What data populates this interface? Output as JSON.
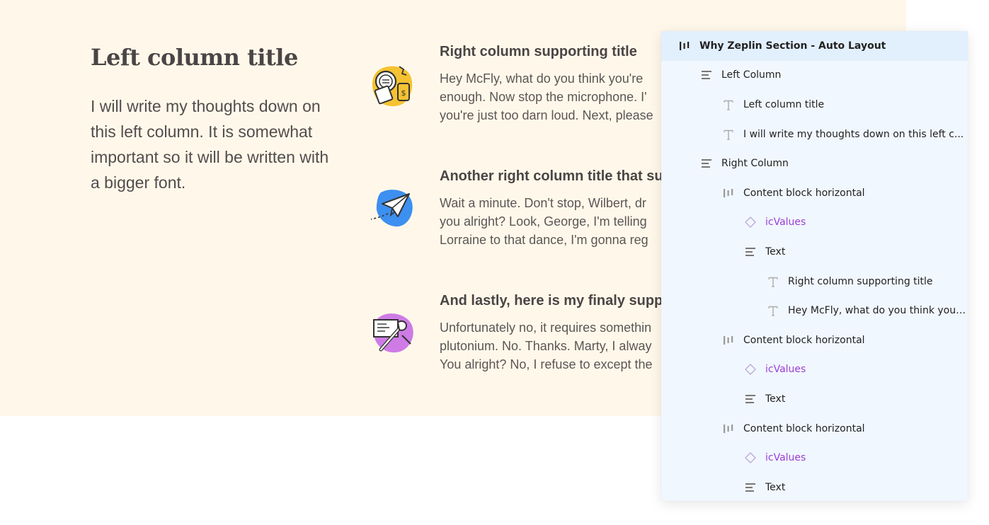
{
  "left_column": {
    "title": "Left column title",
    "body": "I will write my thoughts down on this left column. It is somewhat important so it will be written with a bigger font."
  },
  "right_column": {
    "blocks": [
      {
        "icon": "magnifier-phone-money-icon",
        "title": "Right column supporting title",
        "lines": [
          "Hey McFly, what do you think you're",
          "enough. Now stop the microphone. I'",
          "you're just too darn loud. Next, please"
        ]
      },
      {
        "icon": "paper-plane-icon",
        "title": "Another right column title that su",
        "lines": [
          "Wait a minute. Don't stop, Wilbert, dr",
          "you alright? Look, George, I'm telling",
          "Lorraine to that dance, I'm gonna reg"
        ]
      },
      {
        "icon": "document-wrench-icon",
        "title": "And lastly, here is my finaly supp",
        "lines": [
          "Unfortunately no, it requires somethin",
          "plutonium. No. Thanks. Marty, I alway",
          "You alright? No, I refuse to except the"
        ]
      }
    ]
  },
  "layers_panel": {
    "items": [
      {
        "label": "Why Zeplin Section - Auto Layout",
        "icon": "auto-layout-horizontal-icon",
        "depth": 0,
        "selected": true
      },
      {
        "label": "Left Column",
        "icon": "auto-layout-vertical-icon",
        "depth": 1
      },
      {
        "label": "Left column title",
        "icon": "text-layer-icon",
        "depth": 2
      },
      {
        "label": "I will write my thoughts down on this left c...",
        "icon": "text-layer-icon",
        "depth": 2
      },
      {
        "label": "Right Column",
        "icon": "auto-layout-vertical-icon",
        "depth": 1
      },
      {
        "label": "Content block horizontal",
        "icon": "auto-layout-horizontal-icon",
        "depth": 2
      },
      {
        "label": "icValues",
        "icon": "component-instance-icon",
        "depth": 3,
        "purple": true
      },
      {
        "label": "Text",
        "icon": "auto-layout-vertical-icon",
        "depth": 3
      },
      {
        "label": "Right column supporting title",
        "icon": "text-layer-icon",
        "depth": 4
      },
      {
        "label": "Hey McFly, what do you think you'...",
        "icon": "text-layer-icon",
        "depth": 4
      },
      {
        "label": "Content block horizontal",
        "icon": "auto-layout-horizontal-icon",
        "depth": 2
      },
      {
        "label": "icValues",
        "icon": "component-instance-icon",
        "depth": 3,
        "purple": true
      },
      {
        "label": "Text",
        "icon": "auto-layout-vertical-icon",
        "depth": 3
      },
      {
        "label": "Content block horizontal",
        "icon": "auto-layout-horizontal-icon",
        "depth": 2
      },
      {
        "label": "icValues",
        "icon": "component-instance-icon",
        "depth": 3,
        "purple": true
      },
      {
        "label": "Text",
        "icon": "auto-layout-vertical-icon",
        "depth": 3
      }
    ]
  },
  "colors": {
    "section_background": "#fff8ea",
    "panel_background": "#f1f7fe",
    "selected_row": "#e2effd",
    "component_purple": "#9b3fd6",
    "icon_yellow": "#f6c232",
    "icon_blue": "#3d8ff0",
    "icon_purple": "#cf7be6"
  }
}
